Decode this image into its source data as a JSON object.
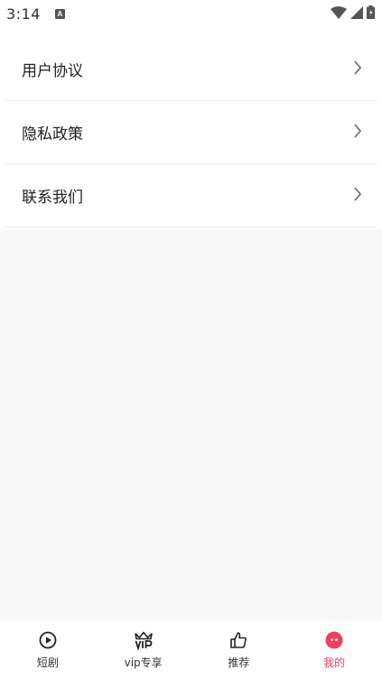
{
  "status_bar": {
    "time": "3:14",
    "notification_badge": "A"
  },
  "menu": {
    "items": [
      {
        "label": "用户协议"
      },
      {
        "label": "隐私政策"
      },
      {
        "label": "联系我们"
      }
    ]
  },
  "tab_bar": {
    "tabs": [
      {
        "label": "短剧",
        "icon": "play-circle-icon"
      },
      {
        "label": "vip专享",
        "icon": "vip-crown-icon"
      },
      {
        "label": "推荐",
        "icon": "thumbs-up-icon"
      },
      {
        "label": "我的",
        "icon": "profile-face-icon",
        "active": true
      }
    ],
    "active_color": "#f0405a"
  }
}
